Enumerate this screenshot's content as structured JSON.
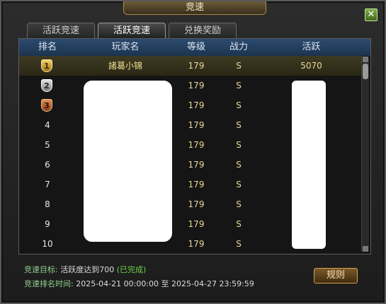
{
  "window": {
    "title": "竞速"
  },
  "tabs": [
    {
      "label": "活跃竞速",
      "active": false
    },
    {
      "label": "活跃竞速",
      "active": true
    },
    {
      "label": "兑换奖励",
      "active": false
    }
  ],
  "table": {
    "headers": [
      "排名",
      "玩家名",
      "等级",
      "战力",
      "活跃"
    ],
    "rows": [
      {
        "rank": "1",
        "name": "諸葛小锦",
        "level": "179",
        "power": "S",
        "activity": "5070"
      },
      {
        "rank": "2",
        "name": "",
        "level": "179",
        "power": "S",
        "activity": ""
      },
      {
        "rank": "3",
        "name": "",
        "level": "179",
        "power": "S",
        "activity": ""
      },
      {
        "rank": "4",
        "name": "",
        "level": "179",
        "power": "S",
        "activity": ""
      },
      {
        "rank": "5",
        "name": "",
        "level": "179",
        "power": "S",
        "activity": ""
      },
      {
        "rank": "6",
        "name": "",
        "level": "179",
        "power": "S",
        "activity": ""
      },
      {
        "rank": "7",
        "name": "",
        "level": "179",
        "power": "S",
        "activity": ""
      },
      {
        "rank": "8",
        "name": "",
        "level": "179",
        "power": "S",
        "activity": ""
      },
      {
        "rank": "9",
        "name": "",
        "level": "179",
        "power": "S",
        "activity": ""
      },
      {
        "rank": "10",
        "name": "",
        "level": "179",
        "power": "S",
        "activity": ""
      }
    ]
  },
  "footer": {
    "goal_label": "竞速目标:",
    "goal_value": "活跃度达到700",
    "goal_status": "(已完成)",
    "time_label": "竞速排名时间:",
    "time_value": "2025-04-21 00:00:00 至 2025-04-27 23:59:59"
  },
  "buttons": {
    "rules": "规则",
    "close": "✕"
  },
  "colors": {
    "accent_gold": "#e9d89a",
    "header_blue": "#2c4a6e",
    "done_green": "#6fd34a"
  }
}
